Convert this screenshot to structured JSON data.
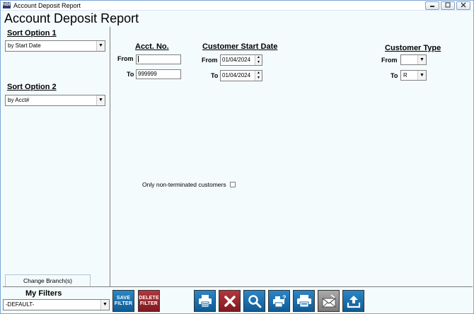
{
  "window": {
    "title": "Account Deposit Report",
    "app_icon_text": "NBF"
  },
  "report": {
    "title": "Account Deposit Report"
  },
  "sort_option_1": {
    "label": "Sort Option 1",
    "selected": "by Start Date"
  },
  "sort_option_2": {
    "label": "Sort Option 2",
    "selected": "by Acct#"
  },
  "branch": {
    "change_label": "Change Branch(s)"
  },
  "filters": {
    "label": "My Filters",
    "selected": "-DEFAULT-"
  },
  "acct_no": {
    "heading": "Acct. No.",
    "from_label": "From",
    "from_value": "",
    "to_label": "To",
    "to_value": "999999"
  },
  "start_date": {
    "heading": "Customer Start Date",
    "from_label": "From",
    "from_value": "01/04/2024",
    "to_label": "To",
    "to_value": "01/04/2024"
  },
  "customer_type": {
    "heading": "Customer Type",
    "from_label": "From",
    "from_value": "",
    "to_label": "To",
    "to_value": "R"
  },
  "options": {
    "non_terminated_label": "Only non-terminated customers",
    "non_terminated_checked": false
  },
  "toolbar": {
    "save_filter_label_1": "SAVE",
    "save_filter_label_2": "FILTER",
    "delete_filter_label_1": "DELETE",
    "delete_filter_label_2": "FILTER"
  },
  "colors": {
    "accent_blue": "#1a6fae",
    "accent_red": "#8e2028",
    "panel_bg": "#f4fbfd"
  }
}
